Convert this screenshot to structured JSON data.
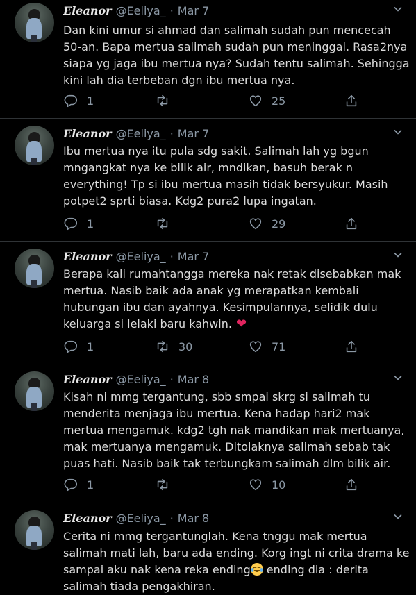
{
  "tweets": [
    {
      "name": "Eleanor",
      "handle": "@Eeliya_",
      "dot": "·",
      "date": "Mar 7",
      "lines": [
        "Dan kini umur si ahmad dan salimah sudah pun mencecah",
        "50-an. Bapa mertua salimah sudah pun meninggal. Rasa2nya",
        "siapa yg jaga ibu mertua nya? Sudah tentu salimah. Sehingga",
        "kini lah dia terbeban dgn ibu mertua nya."
      ],
      "replies": "1",
      "retweets": "",
      "likes": "25"
    },
    {
      "name": "Eleanor",
      "handle": "@Eeliya_",
      "dot": "·",
      "date": "Mar 7",
      "lines": [
        "Ibu mertua nya itu pula sdg sakit. Salimah lah yg bgun",
        "mngangkat nya ke bilik air, mndikan, basuh berak n",
        "everything! Tp si ibu mertua masih tidak bersyukur. Masih",
        "potpet2 sprti biasa. Kdg2 pura2 lupa ingatan."
      ],
      "replies": "1",
      "retweets": "",
      "likes": "29"
    },
    {
      "name": "Eleanor",
      "handle": "@Eeliya_",
      "dot": "·",
      "date": "Mar 7",
      "lines": [
        "Berapa kali rumahtangga mereka nak retak disebabkan mak",
        "mertua. Nasib baik ada anak yg merapatkan kembali",
        "hubungan ibu dan ayahnya. Kesimpulannya, selidik dulu",
        "keluarga si lelaki baru kahwin."
      ],
      "emoji": "❤",
      "replies": "1",
      "retweets": "30",
      "likes": "71"
    },
    {
      "name": "Eleanor",
      "handle": "@Eeliya_",
      "dot": "·",
      "date": "Mar 8",
      "lines": [
        "Kisah ni mmg tergantung, sbb smpai skrg si salimah tu",
        "menderita menjaga ibu mertua. Kena hadap hari2 mak",
        "mertua mengamuk. kdg2 tgh nak mandikan mak mertuanya,",
        "mak mertuanya mengamuk. Ditolaknya salimah sebab tak",
        "puas hati. Nasib baik tak terbungkam salimah dlm bilik air."
      ],
      "replies": "1",
      "retweets": "",
      "likes": "10"
    },
    {
      "name": "Eleanor",
      "handle": "@Eeliya_",
      "dot": "·",
      "date": "Mar 8",
      "lines": [
        "Cerita ni mmg tergantunglah. Kena tnggu mak mertua",
        "salimah mati lah, baru ada ending. Korg ingt ni crita drama ke",
        "sampai aku nak kena reka ending",
        "salimah tiada pengakhiran."
      ],
      "line3_after_emoji": " ending dia : derita"
    }
  ]
}
